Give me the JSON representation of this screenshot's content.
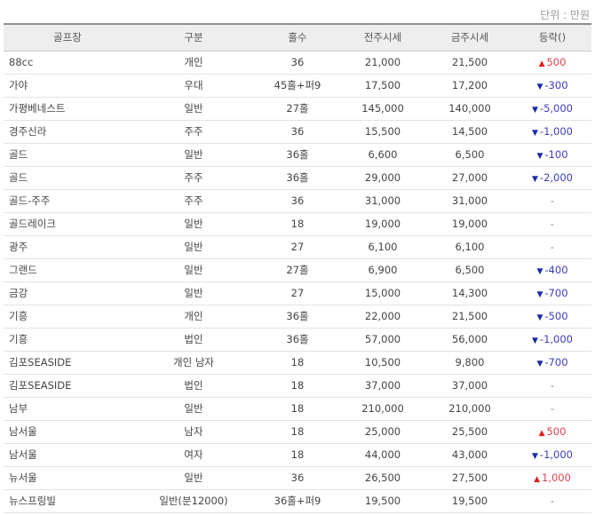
{
  "unit_label": "단위 : 만원",
  "columns": [
    "골프장",
    "구분",
    "홀수",
    "전주시세",
    "금주시세",
    "등락()"
  ],
  "rows": [
    {
      "name": "88cc",
      "type": "개인",
      "holes": "36",
      "prev": "21,000",
      "curr": "21,500",
      "dir": "up",
      "change": "500"
    },
    {
      "name": "가야",
      "type": "우대",
      "holes": "45홀+퍼9",
      "prev": "17,500",
      "curr": "17,200",
      "dir": "down",
      "change": "-300"
    },
    {
      "name": "가평베네스트",
      "type": "일반",
      "holes": "27홀",
      "prev": "145,000",
      "curr": "140,000",
      "dir": "down",
      "change": "-5,000"
    },
    {
      "name": "경주신라",
      "type": "주주",
      "holes": "36",
      "prev": "15,500",
      "curr": "14,500",
      "dir": "down",
      "change": "-1,000"
    },
    {
      "name": "골드",
      "type": "일반",
      "holes": "36홀",
      "prev": "6,600",
      "curr": "6,500",
      "dir": "down",
      "change": "-100"
    },
    {
      "name": "골드",
      "type": "주주",
      "holes": "36홀",
      "prev": "29,000",
      "curr": "27,000",
      "dir": "down",
      "change": "-2,000"
    },
    {
      "name": "골드-주주",
      "type": "주주",
      "holes": "36",
      "prev": "31,000",
      "curr": "31,000",
      "dir": "flat",
      "change": "-"
    },
    {
      "name": "골드레이크",
      "type": "일반",
      "holes": "18",
      "prev": "19,000",
      "curr": "19,000",
      "dir": "flat",
      "change": "-"
    },
    {
      "name": "광주",
      "type": "일반",
      "holes": "27",
      "prev": "6,100",
      "curr": "6,100",
      "dir": "flat",
      "change": "-"
    },
    {
      "name": "그랜드",
      "type": "일반",
      "holes": "27홀",
      "prev": "6,900",
      "curr": "6,500",
      "dir": "down",
      "change": "-400"
    },
    {
      "name": "금강",
      "type": "일반",
      "holes": "27",
      "prev": "15,000",
      "curr": "14,300",
      "dir": "down",
      "change": "-700"
    },
    {
      "name": "기흥",
      "type": "개인",
      "holes": "36홀",
      "prev": "22,000",
      "curr": "21,500",
      "dir": "down",
      "change": "-500"
    },
    {
      "name": "기흥",
      "type": "법인",
      "holes": "36홀",
      "prev": "57,000",
      "curr": "56,000",
      "dir": "down",
      "change": "-1,000"
    },
    {
      "name": "김포SEASIDE",
      "type": "개인 남자",
      "holes": "18",
      "prev": "10,500",
      "curr": "9,800",
      "dir": "down",
      "change": "-700"
    },
    {
      "name": "김포SEASIDE",
      "type": "법인",
      "holes": "18",
      "prev": "37,000",
      "curr": "37,000",
      "dir": "flat",
      "change": "-"
    },
    {
      "name": "남부",
      "type": "일반",
      "holes": "18",
      "prev": "210,000",
      "curr": "210,000",
      "dir": "flat",
      "change": "-"
    },
    {
      "name": "남서울",
      "type": "남자",
      "holes": "18",
      "prev": "25,000",
      "curr": "25,500",
      "dir": "up",
      "change": "500"
    },
    {
      "name": "남서울",
      "type": "여자",
      "holes": "18",
      "prev": "44,000",
      "curr": "43,000",
      "dir": "down",
      "change": "-1,000"
    },
    {
      "name": "뉴서울",
      "type": "일반",
      "holes": "36",
      "prev": "26,500",
      "curr": "27,500",
      "dir": "up",
      "change": "1,000"
    },
    {
      "name": "뉴스프링빌",
      "type": "일반(분12000)",
      "holes": "36홀+퍼9",
      "prev": "19,500",
      "curr": "19,500",
      "dir": "flat",
      "change": "-"
    }
  ],
  "icons": {
    "up": "triangle-up-icon",
    "down": "triangle-down-icon"
  },
  "colors": {
    "up": "#e02020",
    "down": "#1a2aa8",
    "header_bg": "#eeeeee"
  }
}
